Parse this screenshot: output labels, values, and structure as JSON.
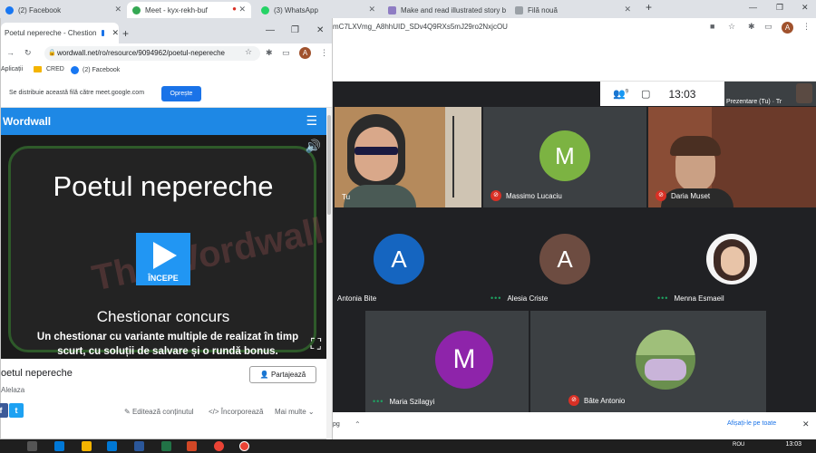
{
  "back_browser": {
    "tabs": [
      {
        "label": "(2) Facebook",
        "color": "#1877f2"
      },
      {
        "label": "Meet - kyx-rekh-buf",
        "color": "#34a853"
      },
      {
        "label": "(3) WhatsApp",
        "color": "#25d366"
      },
      {
        "label": "Make and read illustrated story b",
        "color": "#8e7cc3"
      },
      {
        "label": "Filă nouă",
        "color": "#9aa0a6"
      }
    ],
    "url": "mC7LXVmg_A8hhUID_SDv4Q9RXs5mJ29ro2NxjcOU",
    "avatar": "A"
  },
  "front_browser": {
    "tab_title": "Poetul nepereche - Chestion",
    "url": "wordwall.net/ro/resource/9094962/poetul-nepereche",
    "avatar": "A",
    "bookmarks": [
      "Aplicații",
      "CRED",
      "(2) Facebook"
    ],
    "share_notice": "Se distribuie această filă către meet.google.com",
    "stop_button": "Oprește"
  },
  "wordwall": {
    "logo": "Wordwall",
    "game_title": "Poetul nepereche",
    "watermark": "The Wordwall QUIZ SHOW",
    "play_label": "ÎNCEPE",
    "subtitle": "Chestionar concurs",
    "description": "Un chestionar cu variante multiple de realizat în timp scurt, cu soluții de salvare și o rundă bonus.",
    "activity_title": "oetul nepereche",
    "author": "Alelaza",
    "share_button": "Partajează",
    "links": [
      "Editează conținutul",
      "Încorporează",
      "Mai multe"
    ]
  },
  "meet": {
    "time": "13:03",
    "participant_count": "9",
    "presentation_label": "Prezentare (Tu) · Tr",
    "show_all": "Afișați-le pe toate",
    "partial_text": "pg",
    "participants": [
      {
        "name": "Tu",
        "type": "video",
        "status": "none"
      },
      {
        "name": "Massimo Lucaciu",
        "initial": "M",
        "color": "#7cb342",
        "status": "muted"
      },
      {
        "name": "Daria Muset",
        "type": "video",
        "status": "muted"
      },
      {
        "name": "Antonia Bite",
        "initial": "A",
        "color": "#1565c0",
        "status": "none"
      },
      {
        "name": "Alesia Criste",
        "initial": "A",
        "color": "#6d4c41",
        "status": "talking"
      },
      {
        "name": "Menna Esmaeil",
        "type": "photo",
        "status": "talking"
      },
      {
        "name": "Maria Szilagyi",
        "initial": "M",
        "color": "#8e24aa",
        "status": "talking"
      },
      {
        "name": "Bâte Antonio",
        "type": "photo",
        "status": "muted"
      }
    ]
  },
  "taskbar": {
    "time": "13:03",
    "lang": "ROU"
  }
}
